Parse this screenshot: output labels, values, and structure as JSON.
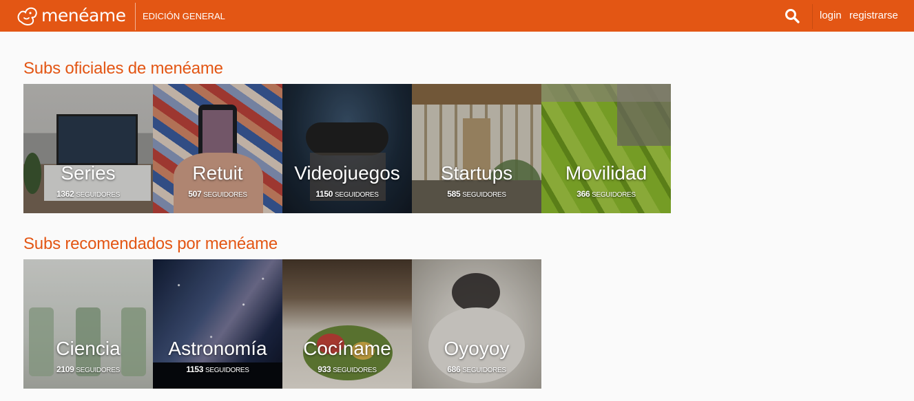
{
  "header": {
    "logo_text": "menéame",
    "edition": "EDICIÓN GENERAL",
    "login": "login",
    "register": "registrarse",
    "brand_color": "#e35614"
  },
  "official": {
    "title": "Subs oficiales de menéame",
    "subs": [
      {
        "name": "Series",
        "followers": "1362",
        "label": "SEGUIDORES"
      },
      {
        "name": "Retuit",
        "followers": "507",
        "label": "SEGUIDORES"
      },
      {
        "name": "Videojuegos",
        "followers": "1150",
        "label": "SEGUIDORES"
      },
      {
        "name": "Startups",
        "followers": "585",
        "label": "SEGUIDORES"
      },
      {
        "name": "Movilidad",
        "followers": "366",
        "label": "SEGUIDORES"
      }
    ]
  },
  "recommended": {
    "title": "Subs recomendados por menéame",
    "subs": [
      {
        "name": "Ciencia",
        "followers": "2109",
        "label": "SEGUIDORES"
      },
      {
        "name": "Astronomía",
        "followers": "1153",
        "label": "SEGUIDORES"
      },
      {
        "name": "Cocíname",
        "followers": "933",
        "label": "SEGUIDORES"
      },
      {
        "name": "Oyoyoy",
        "followers": "686",
        "label": "SEGUIDORES"
      }
    ]
  },
  "icons": {
    "logo": "meneame-logo-icon",
    "search": "search-icon"
  }
}
